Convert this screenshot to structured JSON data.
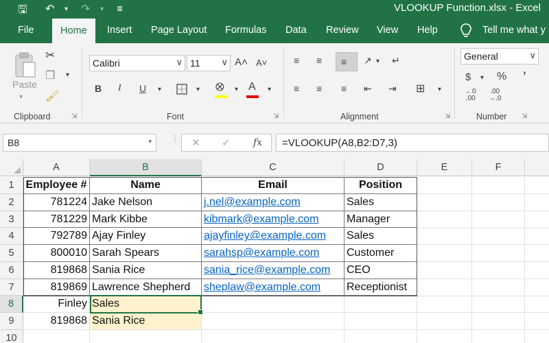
{
  "window": {
    "title": "VLOOKUP Function.xlsx  -  Excel"
  },
  "ribbon_tabs": [
    "File",
    "Home",
    "Insert",
    "Page Layout",
    "Formulas",
    "Data",
    "Review",
    "View",
    "Help"
  ],
  "tell_me": "Tell me what y",
  "ribbon": {
    "clipboard": {
      "label": "Clipboard",
      "paste_label": "Paste"
    },
    "font": {
      "label": "Font",
      "font_name": "Calibri",
      "font_size": "11",
      "bold": "B",
      "italic": "I",
      "underline": "U"
    },
    "alignment": {
      "label": "Alignment"
    },
    "number": {
      "label": "Number",
      "format": "General",
      "currency": "$",
      "percent": "%",
      "comma": "’"
    }
  },
  "formula_bar": {
    "name_box": "B8",
    "formula": "=VLOOKUP(A8,B2:D7,3)"
  },
  "columns": [
    "A",
    "B",
    "C",
    "D",
    "E",
    "F"
  ],
  "rows": [
    "1",
    "2",
    "3",
    "4",
    "5",
    "6",
    "7",
    "8",
    "9",
    "10"
  ],
  "table": {
    "headers": [
      "Employee #",
      "Name",
      "Email",
      "Position"
    ],
    "records": [
      {
        "id": "781224",
        "name": "Jake Nelson",
        "email": "j.nel@example.com",
        "position": "Sales"
      },
      {
        "id": "781229",
        "name": "Mark Kibbe",
        "email": "kibmark@example.com",
        "position": "Manager"
      },
      {
        "id": "792789",
        "name": "Ajay Finley",
        "email": "ajayfinley@example.com",
        "position": "Sales"
      },
      {
        "id": "800010",
        "name": "Sarah Spears",
        "email": "sarahsp@example.com",
        "position": "Customer"
      },
      {
        "id": "819868",
        "name": "Sania Rice",
        "email": "sania_rice@example.com",
        "position": "CEO"
      },
      {
        "id": "819869",
        "name": "Lawrence Shepherd",
        "email": "sheplaw@example.com",
        "position": "Receptionist"
      }
    ]
  },
  "lookups": [
    {
      "a": "Finley",
      "b": "Sales"
    },
    {
      "a": "819868",
      "b": "Sania Rice"
    }
  ],
  "colors": {
    "accent": "#217346",
    "highlight": "#fff2cc",
    "hyperlink": "#0563c1"
  }
}
